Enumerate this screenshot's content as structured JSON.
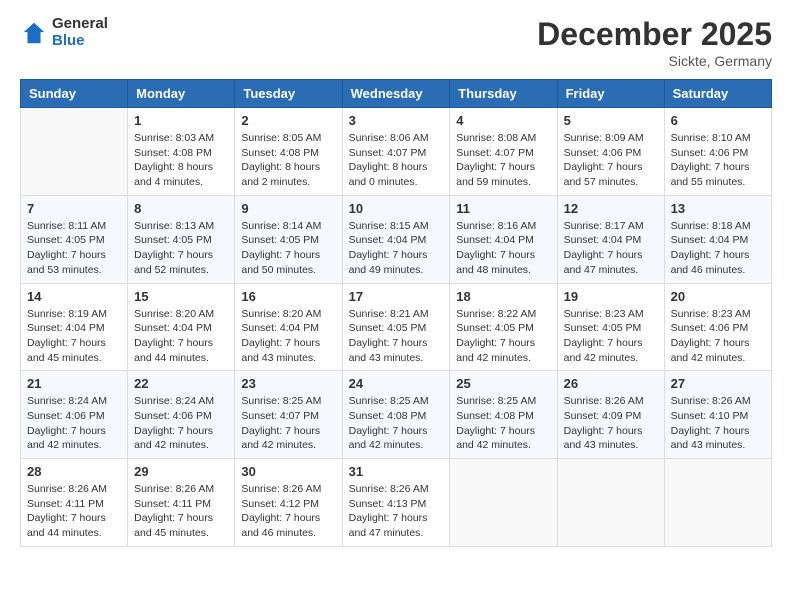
{
  "header": {
    "logo_general": "General",
    "logo_blue": "Blue",
    "month": "December 2025",
    "location": "Sickte, Germany"
  },
  "weekdays": [
    "Sunday",
    "Monday",
    "Tuesday",
    "Wednesday",
    "Thursday",
    "Friday",
    "Saturday"
  ],
  "weeks": [
    [
      {
        "day": "",
        "info": ""
      },
      {
        "day": "1",
        "info": "Sunrise: 8:03 AM\nSunset: 4:08 PM\nDaylight: 8 hours\nand 4 minutes."
      },
      {
        "day": "2",
        "info": "Sunrise: 8:05 AM\nSunset: 4:08 PM\nDaylight: 8 hours\nand 2 minutes."
      },
      {
        "day": "3",
        "info": "Sunrise: 8:06 AM\nSunset: 4:07 PM\nDaylight: 8 hours\nand 0 minutes."
      },
      {
        "day": "4",
        "info": "Sunrise: 8:08 AM\nSunset: 4:07 PM\nDaylight: 7 hours\nand 59 minutes."
      },
      {
        "day": "5",
        "info": "Sunrise: 8:09 AM\nSunset: 4:06 PM\nDaylight: 7 hours\nand 57 minutes."
      },
      {
        "day": "6",
        "info": "Sunrise: 8:10 AM\nSunset: 4:06 PM\nDaylight: 7 hours\nand 55 minutes."
      }
    ],
    [
      {
        "day": "7",
        "info": "Sunrise: 8:11 AM\nSunset: 4:05 PM\nDaylight: 7 hours\nand 53 minutes."
      },
      {
        "day": "8",
        "info": "Sunrise: 8:13 AM\nSunset: 4:05 PM\nDaylight: 7 hours\nand 52 minutes."
      },
      {
        "day": "9",
        "info": "Sunrise: 8:14 AM\nSunset: 4:05 PM\nDaylight: 7 hours\nand 50 minutes."
      },
      {
        "day": "10",
        "info": "Sunrise: 8:15 AM\nSunset: 4:04 PM\nDaylight: 7 hours\nand 49 minutes."
      },
      {
        "day": "11",
        "info": "Sunrise: 8:16 AM\nSunset: 4:04 PM\nDaylight: 7 hours\nand 48 minutes."
      },
      {
        "day": "12",
        "info": "Sunrise: 8:17 AM\nSunset: 4:04 PM\nDaylight: 7 hours\nand 47 minutes."
      },
      {
        "day": "13",
        "info": "Sunrise: 8:18 AM\nSunset: 4:04 PM\nDaylight: 7 hours\nand 46 minutes."
      }
    ],
    [
      {
        "day": "14",
        "info": "Sunrise: 8:19 AM\nSunset: 4:04 PM\nDaylight: 7 hours\nand 45 minutes."
      },
      {
        "day": "15",
        "info": "Sunrise: 8:20 AM\nSunset: 4:04 PM\nDaylight: 7 hours\nand 44 minutes."
      },
      {
        "day": "16",
        "info": "Sunrise: 8:20 AM\nSunset: 4:04 PM\nDaylight: 7 hours\nand 43 minutes."
      },
      {
        "day": "17",
        "info": "Sunrise: 8:21 AM\nSunset: 4:05 PM\nDaylight: 7 hours\nand 43 minutes."
      },
      {
        "day": "18",
        "info": "Sunrise: 8:22 AM\nSunset: 4:05 PM\nDaylight: 7 hours\nand 42 minutes."
      },
      {
        "day": "19",
        "info": "Sunrise: 8:23 AM\nSunset: 4:05 PM\nDaylight: 7 hours\nand 42 minutes."
      },
      {
        "day": "20",
        "info": "Sunrise: 8:23 AM\nSunset: 4:06 PM\nDaylight: 7 hours\nand 42 minutes."
      }
    ],
    [
      {
        "day": "21",
        "info": "Sunrise: 8:24 AM\nSunset: 4:06 PM\nDaylight: 7 hours\nand 42 minutes."
      },
      {
        "day": "22",
        "info": "Sunrise: 8:24 AM\nSunset: 4:06 PM\nDaylight: 7 hours\nand 42 minutes."
      },
      {
        "day": "23",
        "info": "Sunrise: 8:25 AM\nSunset: 4:07 PM\nDaylight: 7 hours\nand 42 minutes."
      },
      {
        "day": "24",
        "info": "Sunrise: 8:25 AM\nSunset: 4:08 PM\nDaylight: 7 hours\nand 42 minutes."
      },
      {
        "day": "25",
        "info": "Sunrise: 8:25 AM\nSunset: 4:08 PM\nDaylight: 7 hours\nand 42 minutes."
      },
      {
        "day": "26",
        "info": "Sunrise: 8:26 AM\nSunset: 4:09 PM\nDaylight: 7 hours\nand 43 minutes."
      },
      {
        "day": "27",
        "info": "Sunrise: 8:26 AM\nSunset: 4:10 PM\nDaylight: 7 hours\nand 43 minutes."
      }
    ],
    [
      {
        "day": "28",
        "info": "Sunrise: 8:26 AM\nSunset: 4:11 PM\nDaylight: 7 hours\nand 44 minutes."
      },
      {
        "day": "29",
        "info": "Sunrise: 8:26 AM\nSunset: 4:11 PM\nDaylight: 7 hours\nand 45 minutes."
      },
      {
        "day": "30",
        "info": "Sunrise: 8:26 AM\nSunset: 4:12 PM\nDaylight: 7 hours\nand 46 minutes."
      },
      {
        "day": "31",
        "info": "Sunrise: 8:26 AM\nSunset: 4:13 PM\nDaylight: 7 hours\nand 47 minutes."
      },
      {
        "day": "",
        "info": ""
      },
      {
        "day": "",
        "info": ""
      },
      {
        "day": "",
        "info": ""
      }
    ]
  ]
}
